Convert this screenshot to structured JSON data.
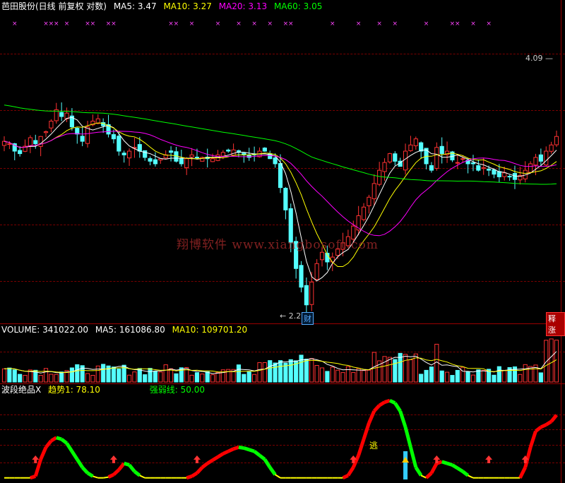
{
  "header": {
    "stock_title": "芭田股份(日线 前复权 对数)",
    "ma5": "MA5: 3.47",
    "ma10": "MA10: 3.27",
    "ma20": "MA20: 3.13",
    "ma60": "MA60: 3.05"
  },
  "annotations": {
    "high_label": "4.09",
    "low_label": "2.27",
    "low_badge": "财",
    "rise_badge": "涨",
    "rise_badge_prefix": "释",
    "escape_label": "逃",
    "watermark": "翔博软件 www.xiangbosoft.com"
  },
  "volume_header": {
    "volume": "VOLUME: 341022.00",
    "ma5": "MA5: 161086.80",
    "ma10": "MA10: 109701.20"
  },
  "osc_header": {
    "name": "波段绝品X",
    "trend": "趋势1: 78.10",
    "strength": "强弱线: 50.00"
  },
  "colors": {
    "up": "#ff3232",
    "down": "#54ffff",
    "ma5": "#ffffff",
    "ma10": "#ffff00",
    "ma20": "#ff00ff",
    "ma60": "#00ff00",
    "grid": "#9a0000"
  },
  "chart_data": [
    {
      "type": "candlestick",
      "title": "芭田股份(日线 前复权 对数)",
      "y_scale": "log",
      "ylim": [
        2.2,
        4.3
      ],
      "high_marker": 4.09,
      "low_marker": 2.27,
      "close": [
        3.38,
        3.36,
        3.3,
        3.28,
        3.34,
        3.41,
        3.36,
        3.42,
        3.46,
        3.55,
        3.65,
        3.59,
        3.62,
        3.5,
        3.44,
        3.38,
        3.5,
        3.55,
        3.57,
        3.51,
        3.44,
        3.4,
        3.3,
        3.27,
        3.3,
        3.33,
        3.3,
        3.25,
        3.22,
        3.2,
        3.24,
        3.27,
        3.29,
        3.22,
        3.2,
        3.24,
        3.27,
        3.25,
        3.25,
        3.24,
        3.24,
        3.27,
        3.29,
        3.3,
        3.31,
        3.29,
        3.27,
        3.25,
        3.27,
        3.3,
        3.3,
        3.24,
        3.2,
        3.02,
        2.86,
        2.64,
        2.48,
        2.37,
        2.27,
        2.4,
        2.51,
        2.58,
        2.52,
        2.55,
        2.6,
        2.64,
        2.68,
        2.75,
        2.82,
        2.88,
        2.95,
        3.05,
        3.15,
        3.21,
        3.28,
        3.22,
        3.18,
        3.3,
        3.35,
        3.4,
        3.3,
        3.2,
        3.15,
        3.33,
        3.28,
        3.3,
        3.23,
        3.21,
        3.24,
        3.2,
        3.2,
        3.15,
        3.17,
        3.15,
        3.12,
        3.1,
        3.13,
        3.1,
        3.08,
        3.11,
        3.15,
        3.2,
        3.25,
        3.22,
        3.3,
        3.35,
        3.42
      ],
      "volume": {
        "series": [
          "VOLUME",
          "MA5",
          "MA10"
        ],
        "last": 341022.0,
        "ma5_last": 161086.8,
        "ma10_last": 109701.2
      },
      "ma_last": {
        "MA5": 3.47,
        "MA10": 3.27,
        "MA20": 3.13,
        "MA60": 3.05
      }
    },
    {
      "type": "line",
      "title": "波段绝品X",
      "series": [
        {
          "name": "趋势1",
          "last": 78.1
        },
        {
          "name": "强弱线",
          "last": 50.0
        }
      ],
      "ylim": [
        0,
        100
      ],
      "values": [
        2,
        2,
        2,
        2,
        2,
        2,
        4,
        25,
        40,
        48,
        52,
        50,
        45,
        35,
        25,
        15,
        8,
        4,
        2,
        2,
        3,
        6,
        12,
        20,
        18,
        10,
        5,
        2,
        2,
        2,
        2,
        2,
        2,
        2,
        2,
        2,
        4,
        8,
        15,
        20,
        24,
        28,
        32,
        35,
        38,
        40,
        39,
        37,
        35,
        30,
        25,
        15,
        6,
        2,
        2,
        2,
        2,
        2,
        2,
        2,
        2,
        2,
        2,
        2,
        2,
        2,
        5,
        15,
        30,
        50,
        70,
        85,
        92,
        96,
        98,
        95,
        85,
        65,
        40,
        15,
        5,
        2,
        8,
        20,
        22,
        20,
        18,
        14,
        10,
        5,
        2,
        2,
        2,
        2,
        2,
        2,
        2,
        2,
        2,
        2,
        15,
        40,
        60,
        65,
        68,
        72,
        80
      ]
    }
  ]
}
